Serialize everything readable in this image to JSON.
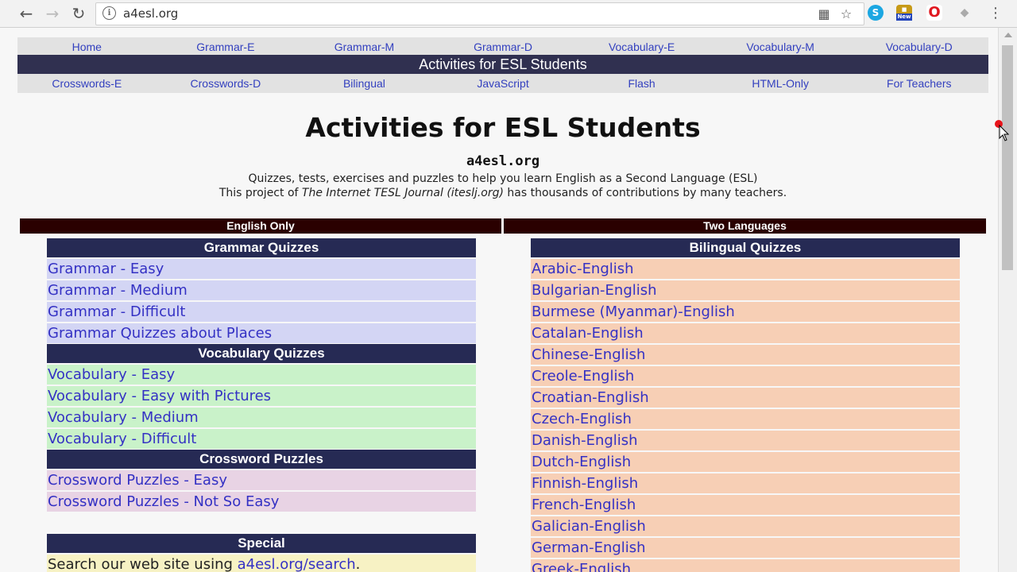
{
  "browser": {
    "url": "a4esl.org",
    "back_icon": "back-arrow-icon",
    "forward_icon": "forward-arrow-icon",
    "reload_icon": "reload-icon",
    "extension_new_badge": "New"
  },
  "top_nav": [
    {
      "label": "Home"
    },
    {
      "label": "Grammar-E"
    },
    {
      "label": "Grammar-M"
    },
    {
      "label": "Grammar-D"
    },
    {
      "label": "Vocabulary-E"
    },
    {
      "label": "Vocabulary-M"
    },
    {
      "label": "Vocabulary-D"
    }
  ],
  "site_bar": "Activities for ESL Students",
  "second_nav": [
    {
      "label": "Crosswords-E"
    },
    {
      "label": "Crosswords-D"
    },
    {
      "label": "Bilingual"
    },
    {
      "label": "JavaScript"
    },
    {
      "label": "Flash"
    },
    {
      "label": "HTML-Only"
    },
    {
      "label": "For Teachers"
    }
  ],
  "hero": {
    "title": "Activities for ESL Students",
    "site": "a4esl.org",
    "line1": "Quizzes, tests, exercises and puzzles to help you learn English as a Second Language (ESL)",
    "line2_prefix": "This project of ",
    "line2_italic": "The Internet TESL Journal (iteslj.org)",
    "line2_suffix": " has thousands of contributions by many teachers."
  },
  "columns": {
    "left_header": "English Only",
    "right_header": "Two Languages"
  },
  "grammar": {
    "title": "Grammar Quizzes",
    "items": [
      "Grammar - Easy",
      "Grammar - Medium",
      "Grammar - Difficult",
      "Grammar Quizzes about Places"
    ]
  },
  "vocabulary": {
    "title": "Vocabulary Quizzes",
    "items": [
      "Vocabulary - Easy",
      "Vocabulary - Easy with Pictures",
      "Vocabulary - Medium",
      "Vocabulary - Difficult"
    ]
  },
  "crossword": {
    "title": "Crossword Puzzles",
    "items": [
      "Crossword Puzzles - Easy",
      "Crossword Puzzles - Not So Easy"
    ]
  },
  "special": {
    "title": "Special",
    "search_prefix": "Search our web site using ",
    "search_link": "a4esl.org/search",
    "search_suffix": "."
  },
  "bilingual": {
    "title": "Bilingual Quizzes",
    "items": [
      "Arabic-English",
      "Bulgarian-English",
      "Burmese (Myanmar)-English",
      "Catalan-English",
      "Chinese-English",
      "Creole-English",
      "Croatian-English",
      "Czech-English",
      "Danish-English",
      "Dutch-English",
      "Finnish-English",
      "French-English",
      "Galician-English",
      "German-English",
      "Greek-English"
    ]
  }
}
